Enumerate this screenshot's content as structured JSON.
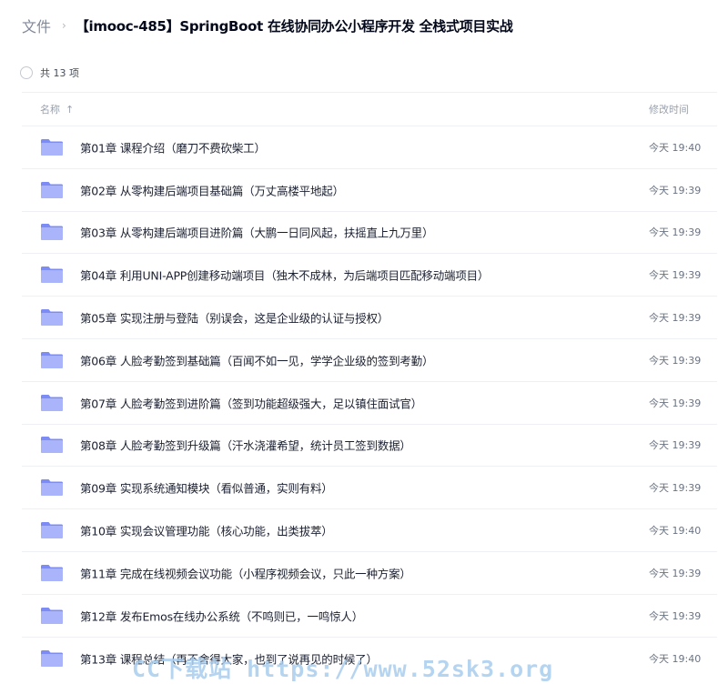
{
  "breadcrumb": {
    "root": "文件",
    "separator": "›",
    "current": "【imooc-485】SpringBoot 在线协同办公小程序开发 全栈式项目实战"
  },
  "summary": {
    "count_text": "共 13 项"
  },
  "columns": {
    "name": "名称",
    "sort_icon": "arrow-up-icon",
    "modified": "修改时间"
  },
  "files": [
    {
      "name": "第01章 课程介绍（磨刀不费砍柴工）",
      "time": "今天 19:40"
    },
    {
      "name": "第02章 从零构建后端项目基础篇（万丈高楼平地起）",
      "time": "今天 19:39"
    },
    {
      "name": "第03章 从零构建后端项目进阶篇（大鹏一日同风起，扶摇直上九万里）",
      "time": "今天 19:39"
    },
    {
      "name": "第04章 利用UNI-APP创建移动端项目（独木不成林，为后端项目匹配移动端项目）",
      "time": "今天 19:39"
    },
    {
      "name": "第05章 实现注册与登陆（别误会，这是企业级的认证与授权）",
      "time": "今天 19:39"
    },
    {
      "name": "第06章 人脸考勤签到基础篇（百闻不如一见，学学企业级的签到考勤）",
      "time": "今天 19:39"
    },
    {
      "name": "第07章 人脸考勤签到进阶篇（签到功能超级强大，足以镇住面试官）",
      "time": "今天 19:39"
    },
    {
      "name": "第08章 人脸考勤签到升级篇（汗水浇灌希望，统计员工签到数据）",
      "time": "今天 19:39"
    },
    {
      "name": "第09章 实现系统通知模块（看似普通，实则有料）",
      "time": "今天 19:39"
    },
    {
      "name": "第10章 实现会议管理功能（核心功能，出类拔萃）",
      "time": "今天 19:40"
    },
    {
      "name": "第11章 完成在线视频会议功能（小程序视频会议，只此一种方案）",
      "time": "今天 19:39"
    },
    {
      "name": "第12章 发布Emos在线办公系统（不鸣则已，一鸣惊人）",
      "time": "今天 19:39"
    },
    {
      "name": "第13章 课程总结（再不舍得大家，也到了说再见的时候了）",
      "time": "今天 19:40"
    }
  ],
  "watermark": "CC下载站 https://www.52sk3.org",
  "colors": {
    "folder_light": "#aab4fb",
    "folder_dark": "#7d8cf4",
    "text": "#03081a",
    "muted": "#818999"
  }
}
